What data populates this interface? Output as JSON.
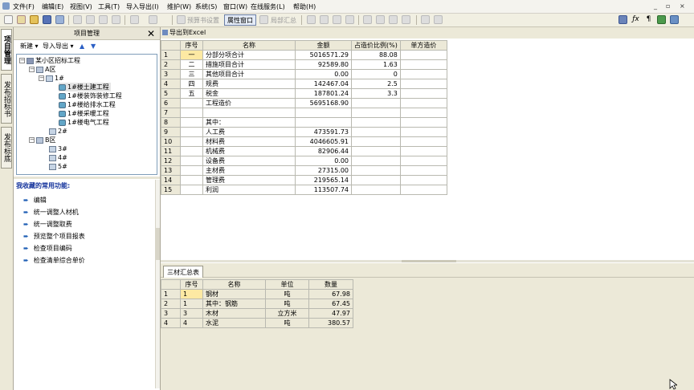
{
  "menubar": {
    "items": [
      "文件(F)",
      "编辑(E)",
      "视图(V)",
      "工具(T)",
      "导入导出(I)",
      "维护(W)",
      "系统(S)",
      "窗口(W)",
      "在线服务(L)",
      "帮助(H)"
    ],
    "window_controls": [
      "_",
      "▫",
      "×"
    ]
  },
  "toolbar": {
    "preset_label": "预算书设置",
    "property_window_label": "属性窗口",
    "partial_summary_label": "局部汇总"
  },
  "side_tabs": [
    "项目管理",
    "发布招标书",
    "发布标底"
  ],
  "left_panel": {
    "title": "项目管理",
    "new_label": "新建",
    "import_export_label": "导入导出",
    "tree": [
      {
        "label": "某小区招标工程",
        "level": 0,
        "icon": "project-icon"
      },
      {
        "label": "A区",
        "level": 1,
        "icon": "folder-icon"
      },
      {
        "label": "1#",
        "level": 2,
        "icon": "building-icon"
      },
      {
        "label": "1#楼土建工程",
        "level": 3,
        "icon": "unit-icon",
        "selected": true
      },
      {
        "label": "1#楼装饰装修工程",
        "level": 3,
        "icon": "unit-icon"
      },
      {
        "label": "1#楼给排水工程",
        "level": 3,
        "icon": "unit-icon"
      },
      {
        "label": "1#楼采暖工程",
        "level": 3,
        "icon": "unit-icon"
      },
      {
        "label": "1#楼电气工程",
        "level": 3,
        "icon": "unit-icon"
      },
      {
        "label": "2#",
        "level": 2,
        "icon": "building-icon"
      },
      {
        "label": "B区",
        "level": 1,
        "icon": "folder-icon"
      },
      {
        "label": "3#",
        "level": 2,
        "icon": "building-icon"
      },
      {
        "label": "4#",
        "level": 2,
        "icon": "building-icon"
      },
      {
        "label": "5#",
        "level": 2,
        "icon": "building-icon"
      }
    ],
    "favorites_title": "我收藏的常用功能:",
    "favorites": [
      "编辑",
      "统一调整人材机",
      "统一调整取费",
      "预览整个项目报表",
      "检查项目编码",
      "检查清单综合单价"
    ]
  },
  "main": {
    "export_label": "导出到Excel",
    "summary_headers": [
      "序号",
      "名称",
      "金额",
      "占造价比例(%)",
      "单方造价"
    ],
    "summary_rows": [
      {
        "rn": "1",
        "seq": "一",
        "name": "分部分项合计",
        "amount": "5016571.29",
        "pct": "88.08",
        "unit": ""
      },
      {
        "rn": "2",
        "seq": "二",
        "name": "措施项目合计",
        "amount": "92589.80",
        "pct": "1.63",
        "unit": ""
      },
      {
        "rn": "3",
        "seq": "三",
        "name": "其他项目合计",
        "amount": "0.00",
        "pct": "0",
        "unit": ""
      },
      {
        "rn": "4",
        "seq": "四",
        "name": "规费",
        "amount": "142467.04",
        "pct": "2.5",
        "unit": ""
      },
      {
        "rn": "5",
        "seq": "五",
        "name": "税金",
        "amount": "187801.24",
        "pct": "3.3",
        "unit": ""
      },
      {
        "rn": "6",
        "seq": "",
        "name": "工程造价",
        "amount": "5695168.90",
        "pct": "",
        "unit": ""
      },
      {
        "rn": "7",
        "seq": "",
        "name": "",
        "amount": "",
        "pct": "",
        "unit": ""
      },
      {
        "rn": "8",
        "seq": "",
        "name": "其中：",
        "amount": "",
        "pct": "",
        "unit": ""
      },
      {
        "rn": "9",
        "seq": "",
        "name": "人工费",
        "amount": "473591.73",
        "pct": "",
        "unit": ""
      },
      {
        "rn": "10",
        "seq": "",
        "name": "材料费",
        "amount": "4046605.91",
        "pct": "",
        "unit": ""
      },
      {
        "rn": "11",
        "seq": "",
        "name": "机械费",
        "amount": "82906.44",
        "pct": "",
        "unit": ""
      },
      {
        "rn": "12",
        "seq": "",
        "name": "设备费",
        "amount": "0.00",
        "pct": "",
        "unit": ""
      },
      {
        "rn": "13",
        "seq": "",
        "name": "主材费",
        "amount": "27315.00",
        "pct": "",
        "unit": ""
      },
      {
        "rn": "14",
        "seq": "",
        "name": "管理费",
        "amount": "219565.14",
        "pct": "",
        "unit": ""
      },
      {
        "rn": "15",
        "seq": "",
        "name": "利润",
        "amount": "113507.74",
        "pct": "",
        "unit": ""
      }
    ],
    "lower_tab_label": "三材汇总表",
    "materials_headers": [
      "序号",
      "名称",
      "单位",
      "数量"
    ],
    "materials_rows": [
      {
        "rn": "1",
        "seq": "1",
        "name": "钢材",
        "unit": "吨",
        "qty": "67.98"
      },
      {
        "rn": "2",
        "seq": "1",
        "name": "其中：钢筋",
        "unit": "吨",
        "qty": "67.45"
      },
      {
        "rn": "3",
        "seq": "3",
        "name": "木材",
        "unit": "立方米",
        "qty": "47.97"
      },
      {
        "rn": "4",
        "seq": "4",
        "name": "水泥",
        "unit": "吨",
        "qty": "380.57"
      }
    ]
  }
}
